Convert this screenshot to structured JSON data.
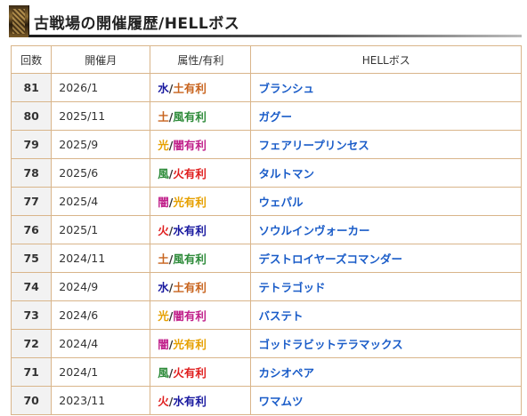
{
  "heading": {
    "title": "古戦場の開催履歴/HELLボス"
  },
  "table": {
    "headers": [
      "回数",
      "開催月",
      "属性/有利",
      "HELLボス"
    ],
    "rows": [
      {
        "no": "81",
        "date": "2026/1",
        "attr_a": "水",
        "attr_a_color": "#1a1aa0",
        "attr_b": "土有利",
        "attr_b_color": "#c8641e",
        "boss": "ブランシュ"
      },
      {
        "no": "80",
        "date": "2025/11",
        "attr_a": "土",
        "attr_a_color": "#c8641e",
        "attr_b": "風有利",
        "attr_b_color": "#2e8b3a",
        "boss": "ガグー"
      },
      {
        "no": "79",
        "date": "2025/9",
        "attr_a": "光",
        "attr_a_color": "#e6a000",
        "attr_b": "闇有利",
        "attr_b_color": "#c0208a",
        "boss": "フェアリープリンセス"
      },
      {
        "no": "78",
        "date": "2025/6",
        "attr_a": "風",
        "attr_a_color": "#2e8b3a",
        "attr_b": "火有利",
        "attr_b_color": "#e01e1e",
        "boss": "タルトマン"
      },
      {
        "no": "77",
        "date": "2025/4",
        "attr_a": "闇",
        "attr_a_color": "#c0208a",
        "attr_b": "光有利",
        "attr_b_color": "#e6a000",
        "boss": "ウェパル"
      },
      {
        "no": "76",
        "date": "2025/1",
        "attr_a": "火",
        "attr_a_color": "#e01e1e",
        "attr_b": "水有利",
        "attr_b_color": "#1a1aa0",
        "boss": "ソウルインヴォーカー"
      },
      {
        "no": "75",
        "date": "2024/11",
        "attr_a": "土",
        "attr_a_color": "#c8641e",
        "attr_b": "風有利",
        "attr_b_color": "#2e8b3a",
        "boss": "デストロイヤーズコマンダー"
      },
      {
        "no": "74",
        "date": "2024/9",
        "attr_a": "水",
        "attr_a_color": "#1a1aa0",
        "attr_b": "土有利",
        "attr_b_color": "#c8641e",
        "boss": "テトラゴッド"
      },
      {
        "no": "73",
        "date": "2024/6",
        "attr_a": "光",
        "attr_a_color": "#e6a000",
        "attr_b": "闇有利",
        "attr_b_color": "#c0208a",
        "boss": "バステト"
      },
      {
        "no": "72",
        "date": "2024/4",
        "attr_a": "闇",
        "attr_a_color": "#c0208a",
        "attr_b": "光有利",
        "attr_b_color": "#e6a000",
        "boss": "ゴッドラビットテラマックス"
      },
      {
        "no": "71",
        "date": "2024/1",
        "attr_a": "風",
        "attr_a_color": "#2e8b3a",
        "attr_b": "火有利",
        "attr_b_color": "#e01e1e",
        "boss": "カシオペア"
      },
      {
        "no": "70",
        "date": "2023/11",
        "attr_a": "火",
        "attr_a_color": "#e01e1e",
        "attr_b": "水有利",
        "attr_b_color": "#1a1aa0",
        "boss": "ワマムツ"
      }
    ]
  }
}
